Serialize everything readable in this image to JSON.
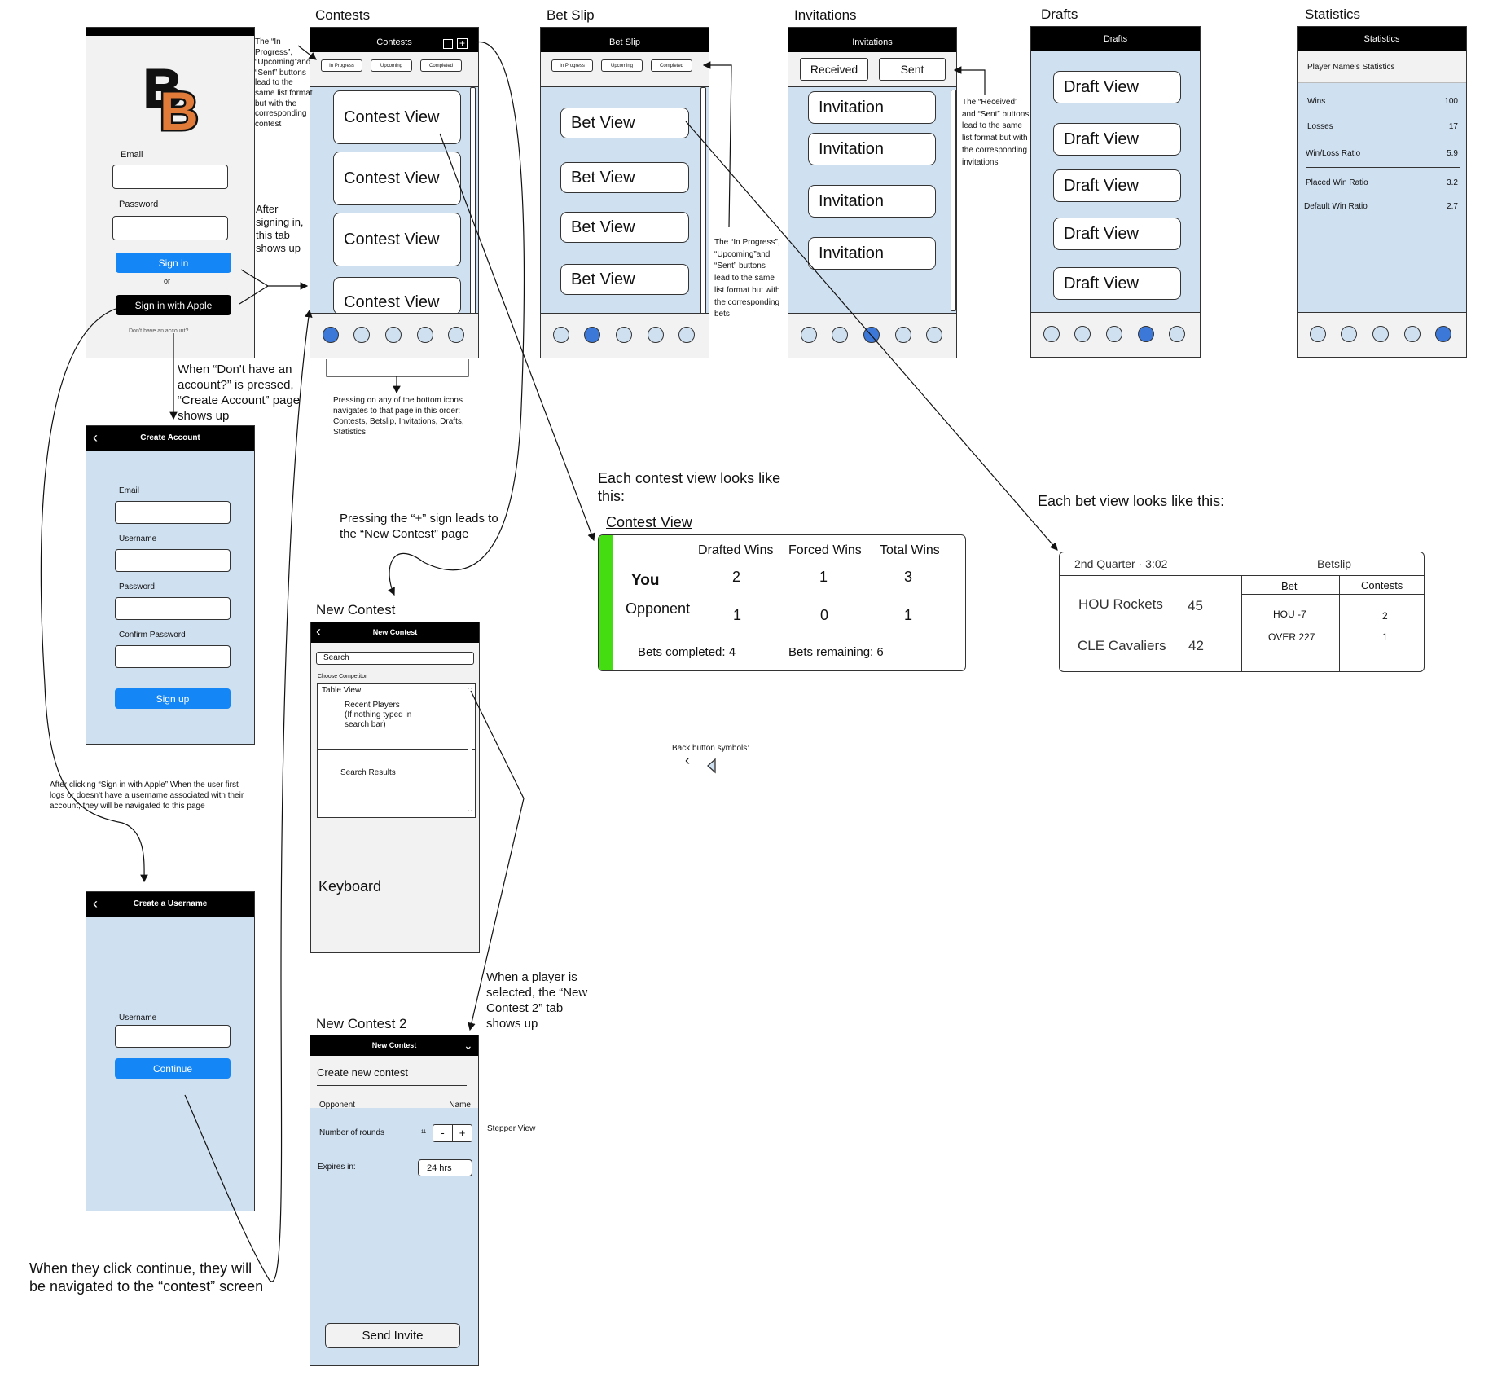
{
  "frame_titles": {
    "contests": "Contests",
    "betslip": "Bet Slip",
    "invitations": "Invitations",
    "drafts": "Drafts",
    "statistics": "Statistics",
    "new_contest": "New Contest",
    "new_contest_2": "New Contest 2"
  },
  "login": {
    "logo": "BB",
    "email_label": "Email",
    "password_label": "Password",
    "sign_in": "Sign in",
    "or": "or",
    "sign_in_apple": "Sign in with Apple",
    "no_account": "Don't have an account?"
  },
  "create_account": {
    "title": "Create Account",
    "email_label": "Email",
    "username_label": "Username",
    "password_label": "Password",
    "confirm_label": "Confirm Password",
    "sign_up": "Sign up"
  },
  "create_username": {
    "title": "Create a Username",
    "username_label": "Username",
    "continue": "Continue"
  },
  "contests": {
    "bar_title": "Contests",
    "segments": [
      "In Progress",
      "Upcoming",
      "Completed"
    ],
    "items": [
      "Contest View",
      "Contest View",
      "Contest View",
      "Contest View"
    ]
  },
  "betslip": {
    "bar_title": "Bet Slip",
    "segments": [
      "In Progress",
      "Upcoming",
      "Completed"
    ],
    "items": [
      "Bet View",
      "Bet View",
      "Bet View",
      "Bet View"
    ]
  },
  "invitations": {
    "bar_title": "Invitations",
    "segments": [
      "Received",
      "Sent"
    ],
    "items": [
      "Invitation",
      "Invitation",
      "Invitation",
      "Invitation"
    ]
  },
  "drafts": {
    "bar_title": "Drafts",
    "items": [
      "Draft View",
      "Draft View",
      "Draft View",
      "Draft View",
      "Draft View"
    ]
  },
  "statistics": {
    "bar_title": "Statistics",
    "header": "Player Name's Statistics",
    "rows": [
      {
        "label": "Wins",
        "value": "100"
      },
      {
        "label": "Losses",
        "value": "17"
      },
      {
        "label": "Win/Loss Ratio",
        "value": "5.9"
      },
      {
        "label": "Placed Win Ratio",
        "value": "3.2"
      },
      {
        "label": "Default Win Ratio",
        "value": "2.7"
      }
    ]
  },
  "new_contest": {
    "bar_title": "New Contest",
    "search": "Search",
    "choose": "Choose Competitor",
    "table_view": "Table View",
    "recent": "Recent Players\n(If nothing typed in\nsearch bar)",
    "results": "Search Results",
    "keyboard": "Keyboard"
  },
  "new_contest_2": {
    "bar_title": "New Contest",
    "heading": "Create new contest",
    "opponent_label": "Opponent",
    "opponent_value": "Name",
    "rounds_label": "Number of rounds",
    "rounds_value": "11",
    "minus": "-",
    "plus": "+",
    "expires_label": "Expires in:",
    "expires_value": "24 hrs",
    "send": "Send Invite",
    "stepper_note": "Stepper View"
  },
  "contest_card": {
    "intro": "Each contest view looks like this:",
    "title": "Contest View",
    "headers": [
      "Drafted Wins",
      "Forced Wins",
      "Total Wins"
    ],
    "you_label": "You",
    "you_values": [
      "2",
      "1",
      "3"
    ],
    "opp_label": "Opponent",
    "opp_values": [
      "1",
      "0",
      "1"
    ],
    "completed": "Bets completed: 4",
    "remaining": "Bets remaining: 6",
    "accent": "#44dd11"
  },
  "bet_card": {
    "intro": "Each bet view looks like this:",
    "quarter": "2nd Quarter · 3:02",
    "title": "Betslip",
    "team1": "HOU Rockets",
    "score1": "45",
    "team2": "CLE Cavaliers",
    "score2": "42",
    "bet_header": "Bet",
    "contests_header": "Contests",
    "bets": [
      "HOU -7",
      "OVER 227"
    ],
    "contests": [
      "2",
      "1"
    ]
  },
  "back_symbols": "Back button symbols:",
  "notes": {
    "segments_contest": "The “In Progress”, “Upcoming”and “Sent” buttons lead to the same list format but with the corresponding contest",
    "after_sign_in": "After signing in, this tab shows up",
    "dont_have": "When “Don't have an account?” is pressed, “Create Account” page shows up",
    "bottom_icons": "Pressing on any of the bottom icons navigates to that page in this order: Contests, Betslip, Invitations, Drafts, Statistics",
    "plus_sign": "Pressing the “+” sign leads to the “New Contest” page",
    "betslip_segments": "The “In Progress”, “Upcoming”and “Sent” buttons lead to the same list format but with the corresponding bets",
    "invite_segments": "The “Received” and “Sent” buttons lead to the same list format but with the corresponding invitations",
    "apple": "After clicking “Sign in with Apple” When the user first logs or doesn't have a username associated with their account, they will be navigated to this page",
    "player_selected": "When a player is selected, the “New Contest 2” tab shows up",
    "continue": "When they click continue, they will be navigated to the “contest” screen"
  }
}
